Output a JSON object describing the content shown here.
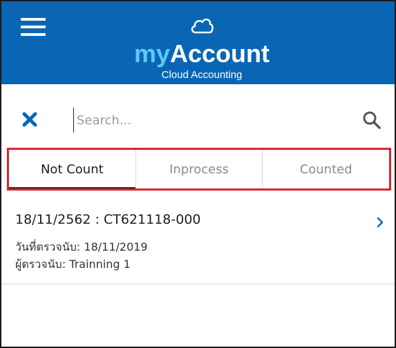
{
  "header": {
    "menu_icon": "hamburger-menu-icon",
    "logo_icon": "cloud-icon",
    "logo_prefix": "my",
    "logo_main": "Account",
    "logo_subtitle": "Cloud Accounting",
    "background_color": "#0a66b5"
  },
  "search": {
    "close_icon": "close-icon",
    "placeholder": "Search...",
    "value": "",
    "search_icon": "search-icon"
  },
  "tabs": [
    {
      "label": "Not Count",
      "active": true
    },
    {
      "label": "Inprocess",
      "active": false
    },
    {
      "label": "Counted",
      "active": false
    }
  ],
  "list": [
    {
      "title": "18/11/2562 : CT621118-000",
      "date_line": "วันที่ตรวจนับ: 18/11/2019",
      "user_line": "ผู้ตรวจนับ: Trainning 1",
      "chevron_icon": "chevron-right-icon"
    }
  ],
  "colors": {
    "brand": "#0a66b5",
    "logo_accent": "#5ec8f2",
    "highlight": "#e0212b",
    "icon_blue": "#0a66b5"
  }
}
